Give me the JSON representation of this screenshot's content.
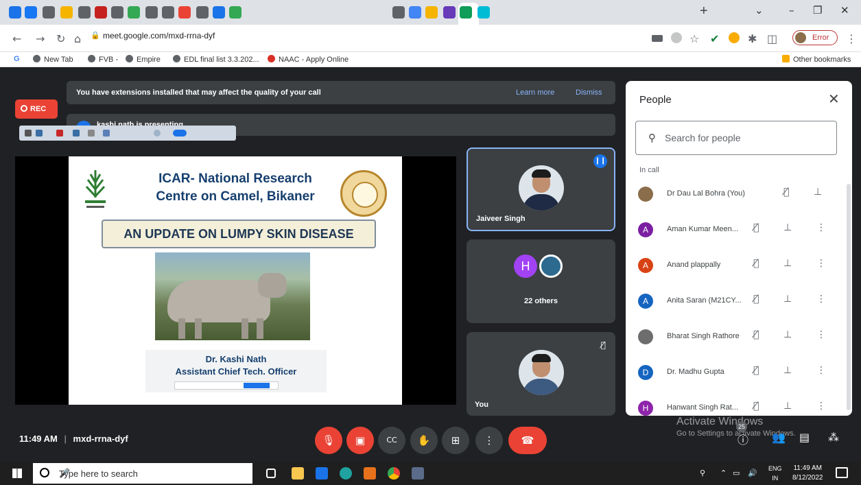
{
  "browser": {
    "url": "meet.google.com/mxd-rrna-dyf",
    "tab_close": "×",
    "new_tab": "+",
    "tab_icons": [
      {
        "color": "#1a73e8",
        "name": "gmail"
      },
      {
        "color": "#1877f2",
        "name": "facebook"
      },
      {
        "color": "#5f6368",
        "name": "globe"
      },
      {
        "color": "#f4b400",
        "name": "slides"
      },
      {
        "color": "#5f6368",
        "name": "globe"
      },
      {
        "color": "#c5221f",
        "name": "ks"
      },
      {
        "color": "#5f6368",
        "name": "globe"
      },
      {
        "color": "#34a853",
        "name": "docs"
      },
      {
        "color": "#5f6368",
        "name": "globe"
      },
      {
        "color": "#5f6368",
        "name": "globe"
      },
      {
        "color": "#ea4335",
        "name": "youtube"
      },
      {
        "color": "#5f6368",
        "name": "globe"
      },
      {
        "color": "#1a73e8",
        "name": "search"
      },
      {
        "color": "#34a853",
        "name": "analytics"
      },
      {
        "color": "#5f6368",
        "name": "globe"
      },
      {
        "color": "#4285f4",
        "name": "google"
      },
      {
        "color": "#f4b400",
        "name": "app"
      },
      {
        "color": "#673ab7",
        "name": "app"
      },
      {
        "color": "#0f9d58",
        "name": "app"
      },
      {
        "color": "#00bcd4",
        "name": "app"
      }
    ],
    "error_label": "Error",
    "bookmarks": [
      "New Tab",
      "FVB -",
      "Empire",
      "EDL final list 3.3.202...",
      "NAAC - Apply Online"
    ],
    "other_bookmarks": "Other bookmarks"
  },
  "meet": {
    "banner_message": "You have extensions installed that may affect the quality of your call",
    "learn_more": "Learn more",
    "dismiss": "Dismiss",
    "presenting": "kashi nath is presenting",
    "rec": "REC",
    "meeting_time": "11:49 AM",
    "meeting_separator": "|",
    "meeting_code": "mxd-rrna-dyf"
  },
  "slide": {
    "title_line1": "ICAR- National Research",
    "title_line2": "Centre on Camel, Bikaner",
    "heading": "AN UPDATE ON LUMPY SKIN DISEASE",
    "presenter_name": "Dr. Kashi Nath",
    "presenter_title": "Assistant Chief Tech. Officer"
  },
  "tiles": {
    "main_name": "Jaiveer Singh",
    "others_initial": "H",
    "others_label": "22 others",
    "you_label": "You"
  },
  "people": {
    "title": "People",
    "search_placeholder": "Search for people",
    "in_call": "In call",
    "participants": [
      {
        "name": "Dr Dau Lal Bohra (You)",
        "initial": "",
        "color": "#8a6d4a"
      },
      {
        "name": "Aman Kumar Meen...",
        "initial": "A",
        "color": "#7b1fa2"
      },
      {
        "name": "Anand plappally",
        "initial": "A",
        "color": "#d84315"
      },
      {
        "name": "Anita Saran (M21CY...",
        "initial": "A",
        "color": "#1565c0"
      },
      {
        "name": "Bharat Singh Rathore",
        "initial": "",
        "color": "#6d6d6d"
      },
      {
        "name": "Dr. Madhu Gupta",
        "initial": "D",
        "color": "#1565c0"
      },
      {
        "name": "Hanwant Singh Rat...",
        "initial": "H",
        "color": "#8e24aa"
      }
    ]
  },
  "windows": {
    "activate_title": "Activate Windows",
    "activate_sub": "Go to Settings to activate Windows.",
    "chat_badge": "25",
    "taskbar_search": "Type here to search",
    "lang_line1": "ENG",
    "lang_line2": "IN",
    "clock_time": "11:49 AM",
    "clock_date": "8/12/2022"
  }
}
